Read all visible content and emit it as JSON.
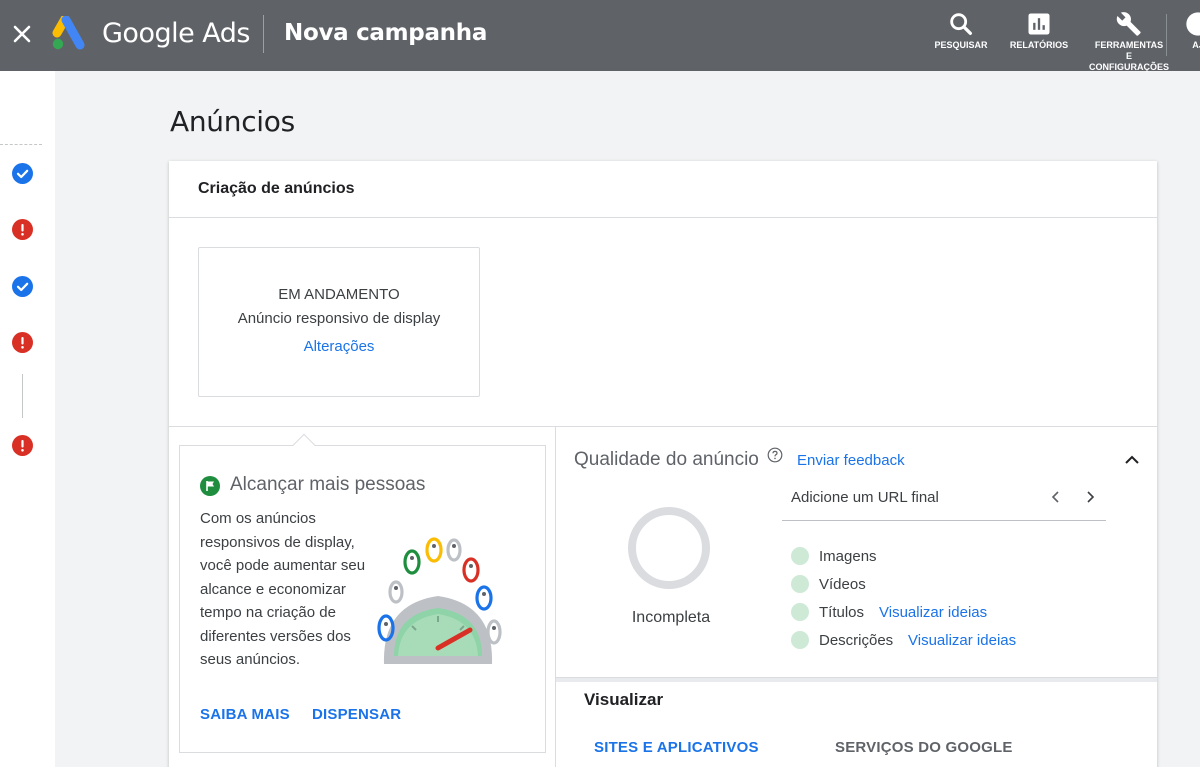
{
  "topbar": {
    "product": "Google Ads",
    "page": "Nova campanha",
    "tools": {
      "search": "PESQUISAR",
      "reports": "RELATÓRIOS",
      "tools_line1": "FERRAMENTAS",
      "tools_line2": "E",
      "tools_line3": "CONFIGURAÇÕES",
      "help": "AJ"
    }
  },
  "rail": {
    "steps": [
      "complete",
      "error",
      "complete",
      "error",
      "error"
    ]
  },
  "page": {
    "title": "Anúncios"
  },
  "creation": {
    "title": "Criação de anúncios",
    "tile": {
      "status": "EM ANDAMENTO",
      "type": "Anúncio responsivo de display",
      "action": "Alterações"
    }
  },
  "tip": {
    "title": "Alcançar mais pessoas",
    "body": "Com os anúncios responsivos de display, você pode aumentar seu alcance e economizar tempo na criação de diferentes versões dos seus anúncios.",
    "learn_more": "SAIBA MAIS",
    "dismiss": "DISPENSAR"
  },
  "quality": {
    "title": "Qualidade do anúncio",
    "feedback": "Enviar feedback",
    "status": "Incompleta",
    "prompt": "Adicione um URL final",
    "items": [
      {
        "label": "Imagens",
        "link": ""
      },
      {
        "label": "Vídeos",
        "link": ""
      },
      {
        "label": "Títulos",
        "link": "Visualizar ideias"
      },
      {
        "label": "Descrições",
        "link": "Visualizar ideias"
      }
    ]
  },
  "preview": {
    "title": "Visualizar",
    "tabs": [
      "SITES E APLICATIVOS",
      "SERVIÇOS DO GOOGLE"
    ]
  },
  "colors": {
    "topbar": "#5f6368",
    "accent": "#1a73e8",
    "error": "#d93025",
    "success": "#1e8e3e",
    "quality_dot": "#ceead6"
  }
}
